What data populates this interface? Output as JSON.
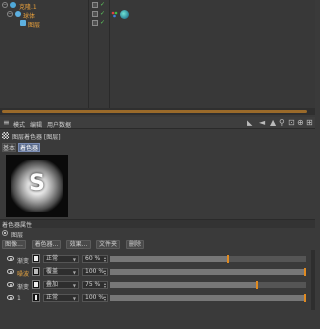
{
  "objects": [
    {
      "name": "克隆.1",
      "depth": 0
    },
    {
      "name": "球体",
      "depth": 1
    },
    {
      "name": "图层",
      "depth": 2
    }
  ],
  "attr_menu": [
    "模式",
    "编辑",
    "用户数据"
  ],
  "attr_title": "图层着色器 [图层]",
  "tabs": {
    "basic": "基本",
    "shader": "着色器"
  },
  "preview_letter": "S",
  "section_title": "着色器属性",
  "layers_label": "图层",
  "buttons": {
    "image": "图像...",
    "shader": "着色器...",
    "effect": "效果...",
    "folder": "文件夹",
    "delete": "删除"
  },
  "layer_rows": [
    {
      "name": "渐变",
      "mode": "正常",
      "pct_text": "60 %",
      "value": 0.6,
      "orange": false
    },
    {
      "name": "噪波",
      "mode": "覆盖",
      "pct_text": "100 %",
      "value": 1.0,
      "orange": true
    },
    {
      "name": "渐变",
      "mode": "叠加",
      "pct_text": "75 %",
      "value": 0.75,
      "orange": false
    },
    {
      "name": "1",
      "mode": "正常",
      "pct_text": "100 %",
      "value": 1.0,
      "orange": false
    }
  ],
  "colors": {
    "accent": "#e08a20",
    "tab_active": "#5a6b8c",
    "object_name": "#e8a03c"
  }
}
